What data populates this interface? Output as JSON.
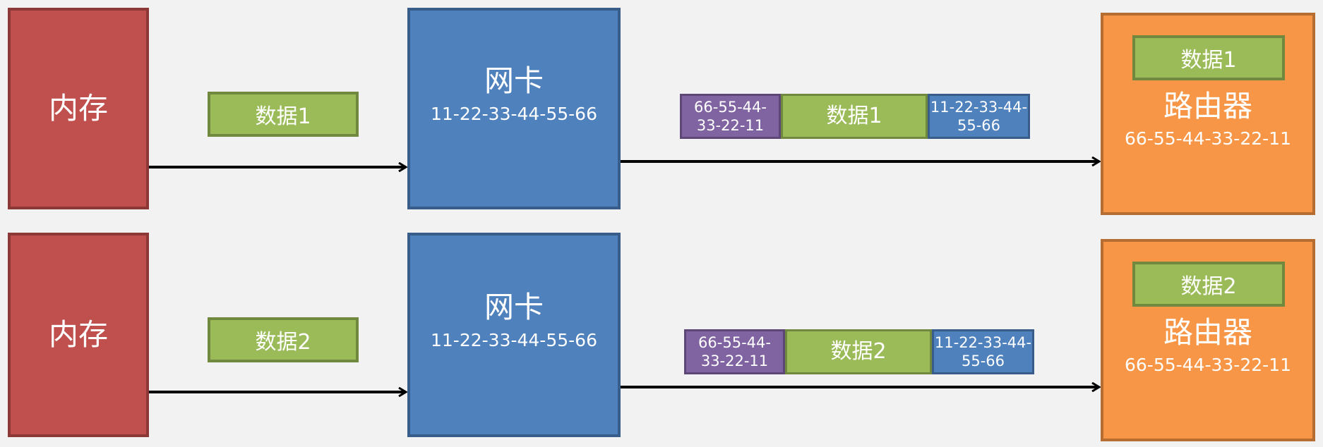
{
  "rows": [
    {
      "memory_label": "内存",
      "packet_label": "数据1",
      "nic": {
        "label": "网卡",
        "mac": "11-22-33-44-55-66"
      },
      "frame": {
        "dst_mac": "66-55-44-33-22-11",
        "data": "数据1",
        "src_mac": "11-22-33-44-55-66"
      },
      "router": {
        "label": "路由器",
        "mac": "66-55-44-33-22-11",
        "data": "数据1"
      }
    },
    {
      "memory_label": "内存",
      "packet_label": "数据2",
      "nic": {
        "label": "网卡",
        "mac": "11-22-33-44-55-66"
      },
      "frame": {
        "dst_mac": "66-55-44-33-22-11",
        "data": "数据2",
        "src_mac": "11-22-33-44-55-66"
      },
      "router": {
        "label": "路由器",
        "mac": "66-55-44-33-22-11",
        "data": "数据2"
      }
    }
  ],
  "colors": {
    "memory": "#c0504d",
    "nic": "#4f81bd",
    "router": "#f79646",
    "data": "#9bbb59",
    "dst_mac": "#8064a2",
    "background": "#f2f2f2"
  }
}
